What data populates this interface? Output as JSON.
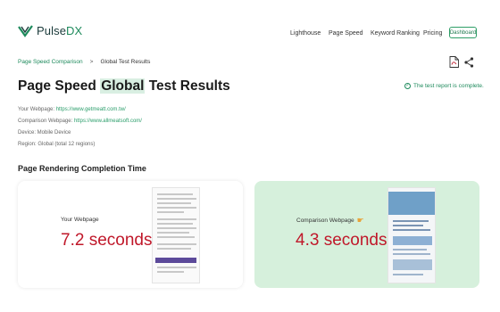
{
  "brand": {
    "name_main": "Pulse",
    "name_accent": "DX",
    "accent_color": "#1e8a5c"
  },
  "nav": {
    "items": [
      "Lighthouse",
      "Page Speed",
      "Keyword Ranking",
      "Pricing"
    ],
    "dashboard_label": "Dashboard"
  },
  "breadcrumb": {
    "link": "Page Speed Comparison",
    "separator": ">",
    "current": "Global Test Results"
  },
  "actions": {
    "pdf_icon": "pdf-icon",
    "share_icon": "share-icon"
  },
  "title": {
    "pre": "Page Speed",
    "highlight": "Global",
    "post": "Test Results"
  },
  "status": {
    "text": "The test report is complete.",
    "color": "#1e8a5c"
  },
  "meta": {
    "webpage_label": "Your Webpage:",
    "webpage_url": "https://www.getmeatt.com.tw/",
    "comparison_label": "Comparison Webpage:",
    "comparison_url": "https://www.allmeatsoft.com/",
    "device": "Device: Mobile Device",
    "region": "Region: Global (total 12 regions)"
  },
  "section": {
    "title": "Page Rendering Completion Time"
  },
  "cards": {
    "yours": {
      "label": "Your Webpage",
      "value": "7.2 seconds"
    },
    "comparison": {
      "label": "Comparison Webpage",
      "value": "4.3 seconds",
      "badge_icon": "pointing-hand-icon"
    }
  },
  "colors": {
    "value_red": "#c0182a",
    "comparison_bg": "#d6f0dc"
  }
}
